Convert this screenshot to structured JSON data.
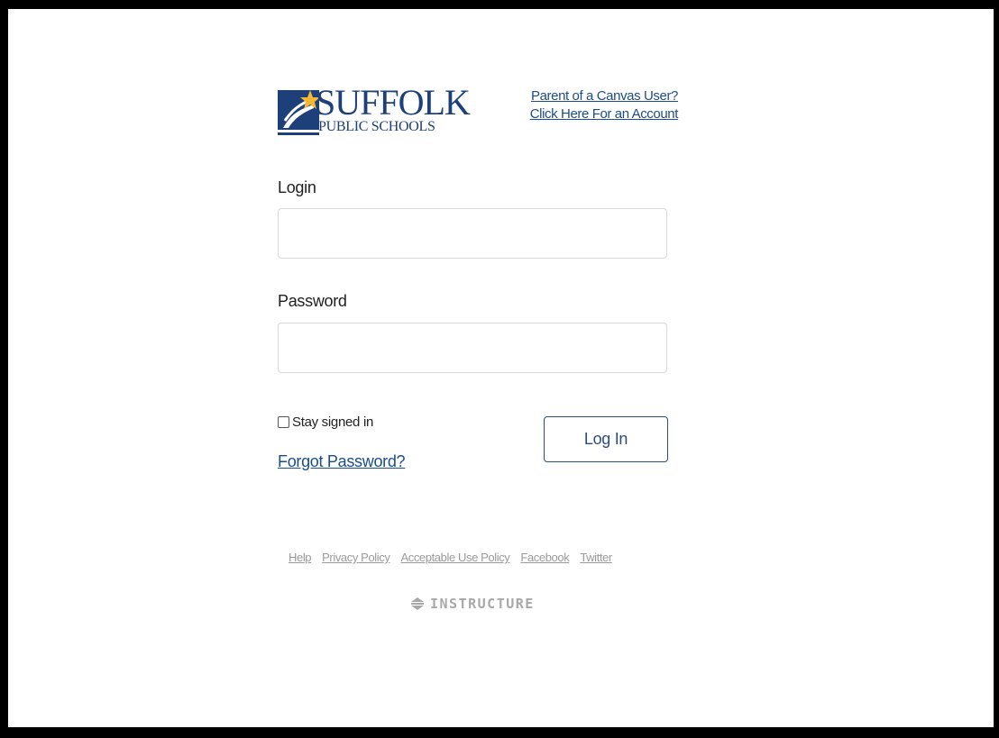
{
  "logo": {
    "name": "SUFFOLK",
    "subtitle": "PUBLIC SCHOOLS",
    "colors": {
      "primary": "#1d3f7a",
      "star": "#f4b833"
    }
  },
  "parent_link": {
    "line1": "Parent of a Canvas User?",
    "line2": "Click Here For an Account"
  },
  "form": {
    "login_label": "Login",
    "login_value": "",
    "password_label": "Password",
    "password_value": "",
    "stay_signed_in_label": "Stay signed in",
    "stay_signed_in_checked": false,
    "forgot_password_label": "Forgot Password?",
    "login_button_label": "Log In"
  },
  "footer": {
    "links": [
      "Help",
      "Privacy Policy",
      "Acceptable Use Policy",
      "Facebook",
      "Twitter"
    ],
    "brand": "INSTRUCTURE",
    "brand_icon": "instructure-logo-icon"
  }
}
